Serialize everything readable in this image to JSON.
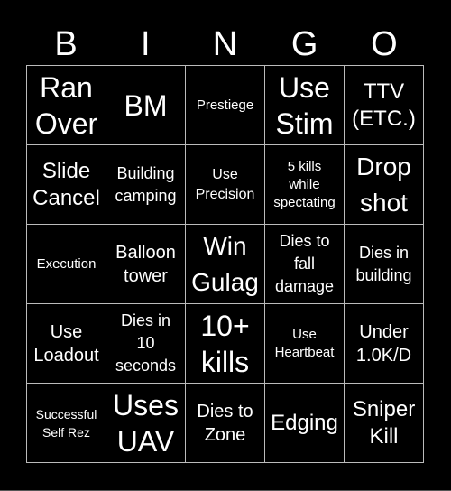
{
  "header": {
    "letters": [
      "B",
      "I",
      "N",
      "G",
      "O"
    ]
  },
  "cells": [
    [
      "Ran Over",
      "BM",
      "Prestiege",
      "Use Stim",
      "TTV (ETC.)"
    ],
    [
      "Slide Cancel",
      "Building camping",
      "Use Precision",
      "5 kills while spectating",
      "Drop shot"
    ],
    [
      "Execution",
      "Balloon tower",
      "Win Gulag",
      "Dies to fall damage",
      "Dies in building"
    ],
    [
      "Use Loadout",
      "Dies in 10 seconds",
      "10+ kills",
      "Use Heartbeat",
      "Under 1.0K/D"
    ],
    [
      "Successful Self Rez",
      "Uses UAV",
      "Dies to Zone",
      "Edging",
      "Sniper Kill"
    ]
  ],
  "colors": {
    "background": "#000000",
    "text": "#ffffff",
    "grid_line": "#bbbbbb"
  }
}
